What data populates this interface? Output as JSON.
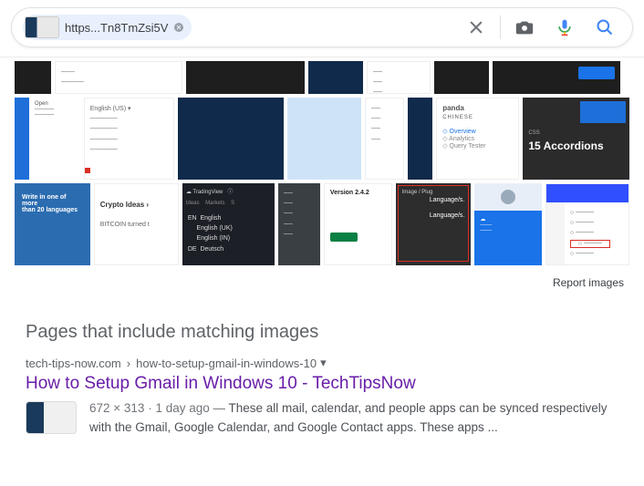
{
  "search": {
    "chip_text": "https...Tn8TmZsi5V"
  },
  "tiles": {
    "accordions": "15 Accordions",
    "panda": "panda",
    "chinese": "CHINESE",
    "overview": "Overview",
    "analytics": "Analytics",
    "querytester": "Query Tester",
    "write_l1": "Write in one of more",
    "write_l2": "than 20 languages",
    "crypto": "Crypto Ideas ›",
    "bitcoin": "BITCOIN turned t",
    "tv": "TradingView",
    "ideas": "Ideas",
    "markets": "Markets",
    "english": "English",
    "englishuk": "English (UK)",
    "englishin": "English (IN)",
    "deutsch": "Deutsch",
    "version": "Version 2.4.2",
    "lang": "Language/s."
  },
  "report": "Report images",
  "section_heading": "Pages that include matching images",
  "result": {
    "domain": "tech-tips-now.com",
    "path": "how-to-setup-gmail-in-windows-10",
    "title": "How to Setup Gmail in Windows 10 - TechTipsNow",
    "dims": "672 × 313",
    "date": "1 day ago",
    "snippet": "These all mail, calendar, and people apps can be synced respectively with the Gmail, Google Calendar, and Google Contact apps. These apps ..."
  }
}
